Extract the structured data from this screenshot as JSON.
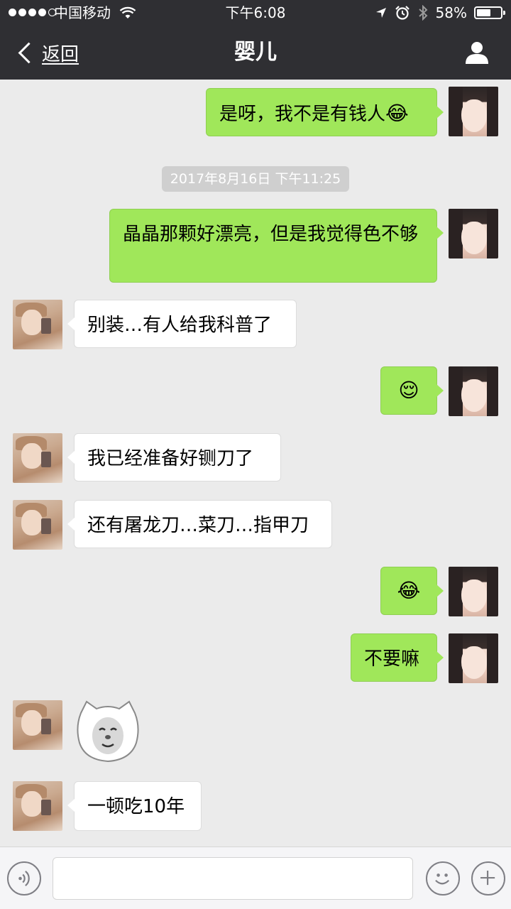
{
  "status_bar": {
    "carrier": "中国移动",
    "time": "下午6:08",
    "battery": "58%",
    "battery_level": 0.58,
    "signal_bars_filled": 4,
    "signal_bars_total": 5
  },
  "nav": {
    "back_label": "返回",
    "title": "婴儿"
  },
  "timestamp": "2017年8月16日 下午11:25",
  "messages": [
    {
      "sender": "self",
      "text": "是呀，我不是有钱人",
      "emoji": "😂"
    },
    {
      "sender": "self",
      "text": "晶晶那颗好漂亮，但是我觉得色不够"
    },
    {
      "sender": "other",
      "text": "别装…有人给我科普了"
    },
    {
      "sender": "self",
      "text": "",
      "emoji": "😌"
    },
    {
      "sender": "other",
      "text": "我已经准备好铡刀了"
    },
    {
      "sender": "other",
      "text": "还有屠龙刀…菜刀…指甲刀"
    },
    {
      "sender": "self",
      "text": "",
      "emoji": "😂"
    },
    {
      "sender": "self",
      "text": "不要嘛"
    },
    {
      "sender": "other",
      "text": "",
      "sticker": "cat-face-sticker"
    },
    {
      "sender": "other",
      "text": "一顿吃10年"
    }
  ],
  "input": {
    "value": "",
    "placeholder": ""
  },
  "icons": {
    "voice": "voice-icon",
    "emoji": "emoji-icon",
    "plus": "plus-icon",
    "profile": "person-icon",
    "back": "chevron-left-icon"
  },
  "colors": {
    "bar_bg": "#2f2f33",
    "chat_bg": "#ebebeb",
    "self_bubble": "#a0e75a",
    "other_bubble": "#ffffff"
  }
}
